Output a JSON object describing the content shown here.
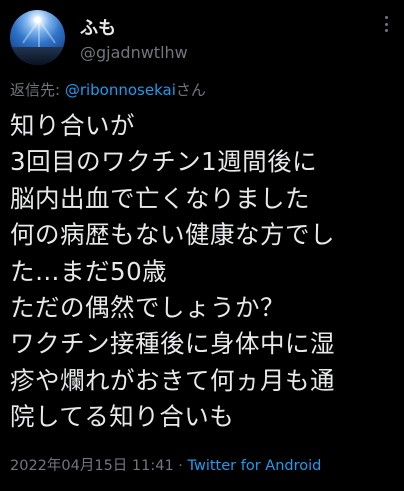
{
  "author": {
    "display_name": "ふも",
    "handle": "@gjadnwtlhw"
  },
  "reply_to": {
    "label": "返信先: ",
    "mention": "@ribonnosekai",
    "suffix": "さん"
  },
  "tweet": {
    "lines": [
      "知り合いが",
      "3回目のワクチン1週間後に",
      "脳内出血で亡くなりました",
      "何の病歴もない健康な方でし",
      "た…まだ50歳",
      "ただの偶然でしょうか？",
      "ワクチン接種後に身体中に湿",
      "疹や爛れがおきて何ヵ月も通",
      "院してる知り合いも"
    ]
  },
  "meta": {
    "timestamp": "2022年04月15日 11:41",
    "separator": " · ",
    "source": "Twitter for Android"
  },
  "icons": {
    "avatar": "sky-sun-avatar",
    "more": "more-options-icon"
  },
  "colors": {
    "background": "#000000",
    "text": "#e7e9ea",
    "muted": "#71767b",
    "accent": "#1d9bf0"
  }
}
